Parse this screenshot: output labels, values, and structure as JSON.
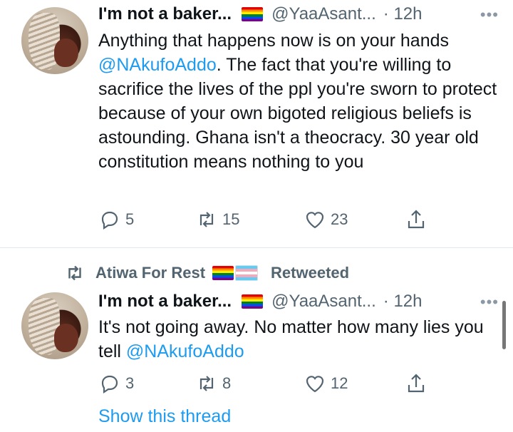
{
  "tweets": [
    {
      "name": "I'm not a baker...",
      "handle": "@YaaAsant...",
      "time": "· 12h",
      "more": "•••",
      "text_before": "Anything that happens now is on your hands ",
      "mention": "@NAkufoAddo",
      "text_after": ". The fact that you're willing to sacrifice the lives of the ppl you're sworn to protect because of your own bigoted religious beliefs is astounding. Ghana isn't a theocracy. 30 year old constitution means nothing to you",
      "replies": "5",
      "retweets": "15",
      "likes": "23"
    },
    {
      "name": "I'm not a baker...",
      "handle": "@YaaAsant...",
      "time": "· 12h",
      "more": "•••",
      "text_before": "It's not going away. No matter how many lies you tell ",
      "mention": "@NAkufoAddo",
      "text_after": "",
      "replies": "3",
      "retweets": "8",
      "likes": "12"
    }
  ],
  "retweet_context": {
    "user": "Atiwa For Rest",
    "label": "Retweeted"
  },
  "show_thread": "Show this thread",
  "colors": {
    "accent": "#1d9bf0",
    "secondary_text": "#536471",
    "divider": "#e1e8ed"
  },
  "icons": {
    "reply": "speech-bubble-icon",
    "retweet": "retweet-arrows-icon",
    "like": "heart-outline-icon",
    "share": "share-upload-icon",
    "more": "more-dots-icon"
  }
}
